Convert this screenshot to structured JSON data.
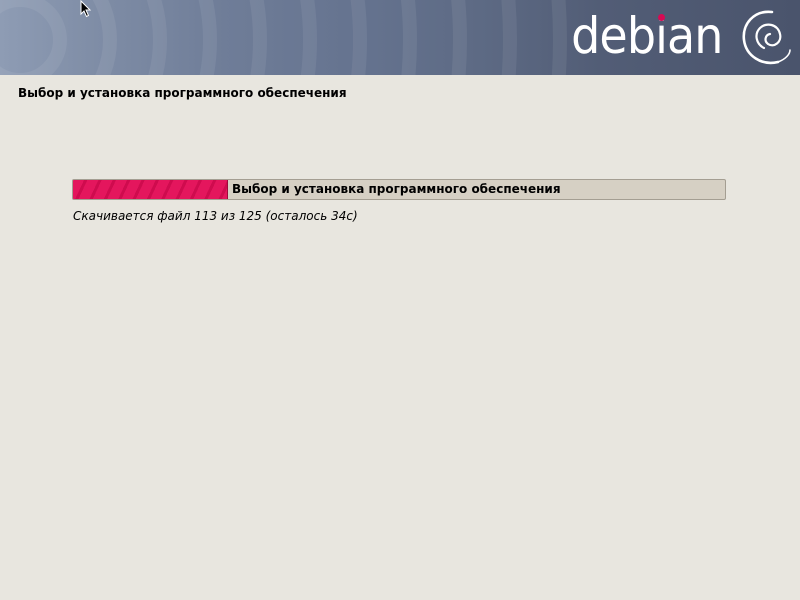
{
  "header": {
    "brand": "debian",
    "brand_color": "#ffffff",
    "accent_color": "#d70a53",
    "logo_icon": "debian-swirl-icon"
  },
  "page": {
    "title": "Выбор и установка программного обеспечения"
  },
  "progress": {
    "label": "Выбор и установка программного обеспечения",
    "fraction": 0.236,
    "fill_color": "#e4165d"
  },
  "status": {
    "text": "Скачивается файл 113 из 125 (осталось 34с)"
  },
  "cursor": {
    "icon": "arrow-cursor-icon"
  }
}
